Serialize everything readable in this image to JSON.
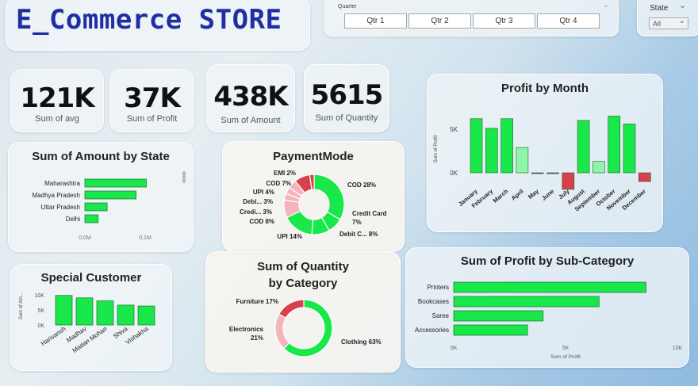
{
  "title": "E_Commerce STORE",
  "quarter_slicer": {
    "label": "Quarter",
    "options": [
      "Qtr 1",
      "Qtr 2",
      "Qtr 3",
      "Qtr 4"
    ]
  },
  "state_slicer": {
    "label": "State",
    "value": "All"
  },
  "kpis": [
    {
      "value": "121K",
      "label": "Sum of avg"
    },
    {
      "value": "37K",
      "label": "Sum of Profit"
    },
    {
      "value": "438K",
      "label": "Sum of Amount"
    },
    {
      "value": "5615",
      "label": "Sum of Quantity"
    }
  ],
  "colors": {
    "positive": "#19e84a",
    "light_green": "#8ff5a8",
    "negative": "#d9404d",
    "pink": "#f3b4ba",
    "title_blue": "#1f2fa3"
  },
  "chart_data": [
    {
      "id": "profit_by_month",
      "type": "bar",
      "title": "Profit by Month",
      "ylabel": "Sum of Profit",
      "yticks": [
        "5K",
        "0K"
      ],
      "categories": [
        "January",
        "February",
        "March",
        "April",
        "May",
        "June",
        "July",
        "August",
        "September",
        "October",
        "November",
        "December"
      ],
      "values": [
        6200,
        5100,
        6200,
        2900,
        -100,
        -100,
        -1900,
        6000,
        1300,
        6500,
        5600,
        -1000
      ],
      "ylim": [
        -2500,
        8000
      ]
    },
    {
      "id": "amount_by_state",
      "type": "bar",
      "orientation": "horizontal",
      "title": "Sum of Amount by State",
      "categories": [
        "Maharashtra",
        "Madhya Pradesh",
        "Uttar Pradesh",
        "Delhi"
      ],
      "values": [
        102000,
        85000,
        37000,
        22000
      ],
      "xticks": [
        "0.0M",
        "0.1M"
      ],
      "xlim": [
        0,
        100000
      ]
    },
    {
      "id": "payment_mode",
      "type": "pie",
      "title": "PaymentMode",
      "labels": [
        "COD 28%",
        "Credit Card 7%",
        "Debit C... 8%",
        "UPI 14%",
        "COD 8%",
        "Credi... 3%",
        "Debi... 3%",
        "UPI 4%",
        "COD 7%",
        "EMI 2%"
      ],
      "values": [
        28,
        7,
        8,
        14,
        8,
        3,
        3,
        4,
        7,
        2
      ]
    },
    {
      "id": "special_customer",
      "type": "bar",
      "title": "Special Customer",
      "ylabel": "Sum of Am...",
      "yticks": [
        "10K",
        "5K",
        "0K"
      ],
      "categories": [
        "Harivansh",
        "Madhav",
        "Madan Mohan",
        "Shiva",
        "Vishakha"
      ],
      "values": [
        9800,
        9000,
        8000,
        6600,
        6300
      ],
      "ylim": [
        0,
        10000
      ]
    },
    {
      "id": "quantity_by_category",
      "type": "pie",
      "title": "Sum of Quantity by Category",
      "labels": [
        "Clothing 63%",
        "Electronics 21%",
        "Furniture 17%"
      ],
      "values": [
        63,
        21,
        17
      ]
    },
    {
      "id": "profit_by_subcategory",
      "type": "bar",
      "orientation": "horizontal",
      "title": "Sum of Profit by Sub-Category",
      "xlabel": "Sum of Profit",
      "categories": [
        "Printers",
        "Bookcases",
        "Saree",
        "Accessories"
      ],
      "values": [
        8600,
        6500,
        4000,
        3300
      ],
      "xticks": [
        "0K",
        "5K",
        "10K"
      ],
      "xlim": [
        0,
        10000
      ]
    }
  ]
}
